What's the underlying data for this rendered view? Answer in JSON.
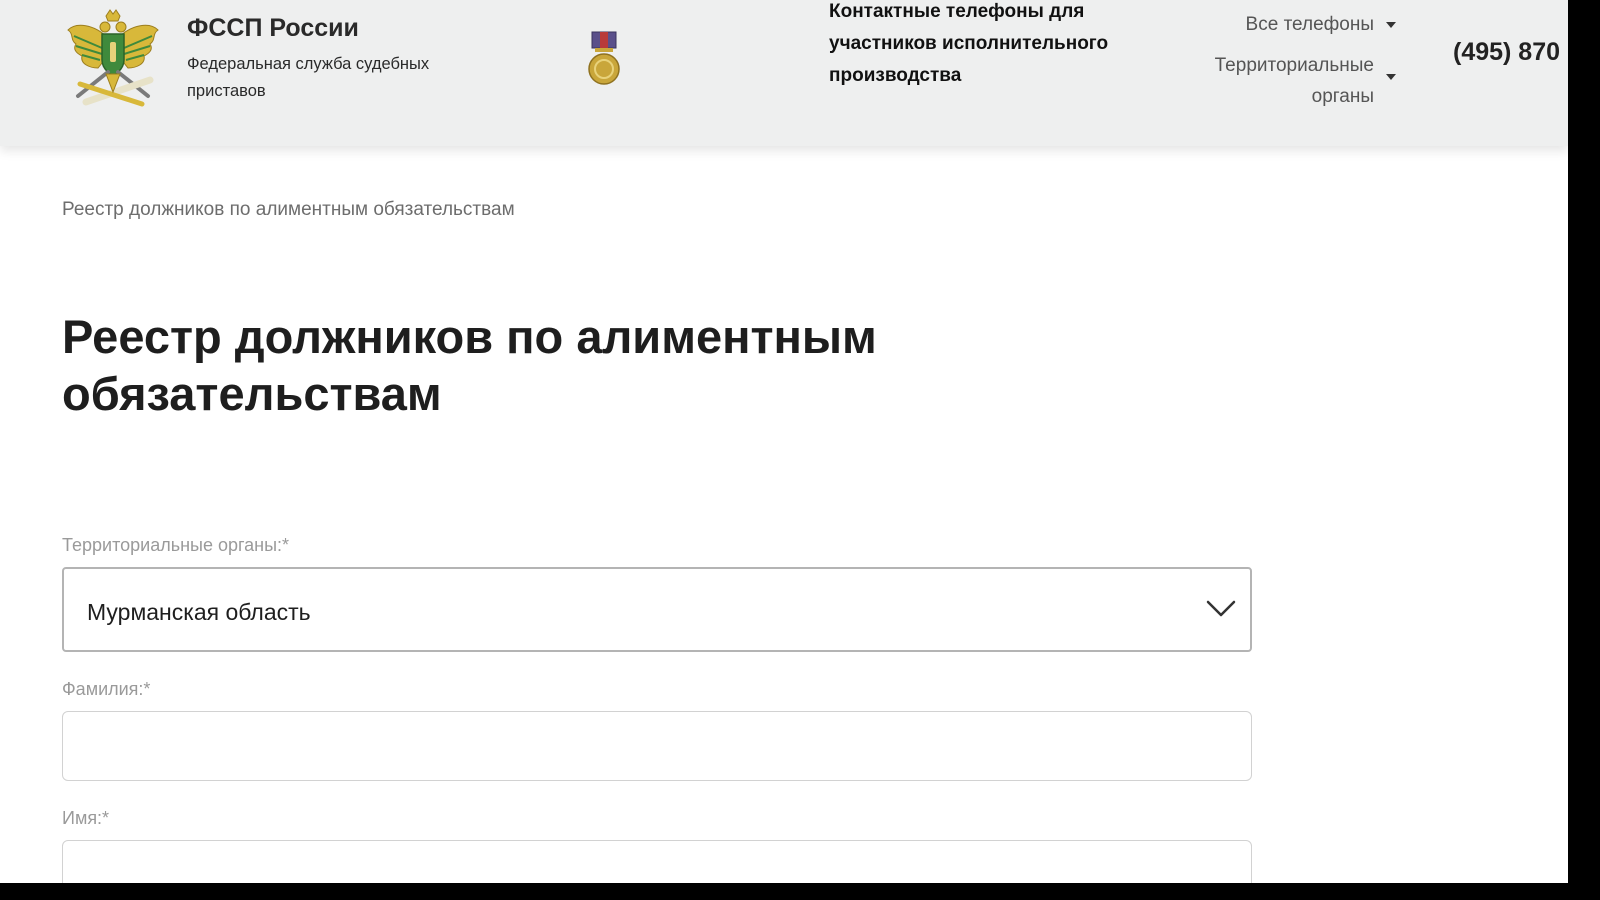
{
  "header": {
    "brand_title": "ФССП России",
    "brand_subtitle": "Федеральная служба судебных приставов",
    "contacts_title": "Контактные телефоны для участников исполнительного производства",
    "menu_all_phones": "Все телефоны",
    "menu_territorial": "Территориальные органы",
    "phone": "(495) 870"
  },
  "breadcrumb": "Реестр должников по алиментным обязательствам",
  "page_title": "Реестр должников по алиментным обязательствам",
  "form": {
    "territorial_label": "Территориальные органы:*",
    "territorial_value": "Мурманская область",
    "surname_label": "Фамилия:*",
    "surname_value": "",
    "name_label": "Имя:*",
    "name_value": ""
  },
  "colors": {
    "header_bg": "#eeefef",
    "emblem_gold": "#d8b83a",
    "emblem_green": "#3f8a3c"
  },
  "icons": {
    "emblem": "fssp-eagle-emblem",
    "medal": "medal-icon",
    "caret": "caret-down-icon",
    "chevron": "chevron-down-icon"
  }
}
